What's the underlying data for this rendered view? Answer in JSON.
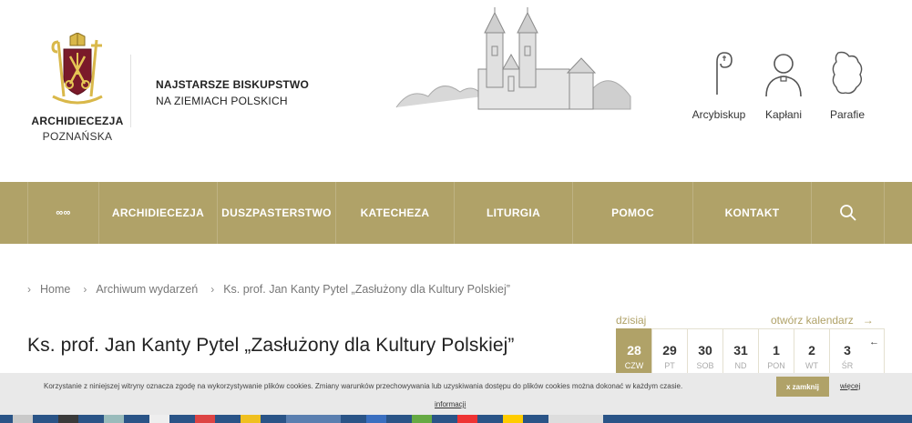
{
  "header": {
    "logo_name": "ARCHIDIECEZJA",
    "logo_sub": "POZNAŃSKA",
    "tagline_1": "NAJSTARSZE BISKUPSTWO",
    "tagline_2": "NA ZIEMIACH POLSKICH",
    "quick_links": [
      {
        "label": "Arcybiskup",
        "icon": "crozier-icon"
      },
      {
        "label": "Kapłani",
        "icon": "priest-icon"
      },
      {
        "label": "Parafie",
        "icon": "map-outline-icon"
      }
    ]
  },
  "nav": {
    "items": [
      {
        "label": "∞∞"
      },
      {
        "label": "ARCHIDIECEZJA"
      },
      {
        "label": "DUSZPASTERSTWO"
      },
      {
        "label": "KATECHEZA"
      },
      {
        "label": "LITURGIA"
      },
      {
        "label": "POMOC"
      },
      {
        "label": "KONTAKT"
      }
    ],
    "search_icon": "search-icon",
    "color": "#b0a268"
  },
  "breadcrumb": [
    "Home",
    "Archiwum wydarzeń",
    "Ks. prof. Jan Kanty Pytel „Zasłużony dla Kultury Polskiej”"
  ],
  "article": {
    "title": "Ks. prof. Jan Kanty Pytel „Zasłużony dla Kultury Polskiej”"
  },
  "calendar": {
    "today_label": "dzisiaj",
    "open_label": "otwórz kalendarz",
    "days": [
      {
        "num": "28",
        "name": "CZW",
        "active": true
      },
      {
        "num": "29",
        "name": "PT"
      },
      {
        "num": "30",
        "name": "SOB"
      },
      {
        "num": "31",
        "name": "ND"
      },
      {
        "num": "1",
        "name": "PON"
      },
      {
        "num": "2",
        "name": "WT"
      },
      {
        "num": "3",
        "name": "ŚR"
      }
    ],
    "prev_symbol": "←"
  },
  "cookie": {
    "text": "Korzystanie z niniejszej witryny oznacza zgodę na wykorzystywanie plików cookies. Zmiany warunków przechowywania lub uzyskiwania dostępu do plików cookies można dokonać w każdym czasie.",
    "close_label": "x zamknij",
    "more_1": "więcej",
    "more_2": "informacji"
  }
}
